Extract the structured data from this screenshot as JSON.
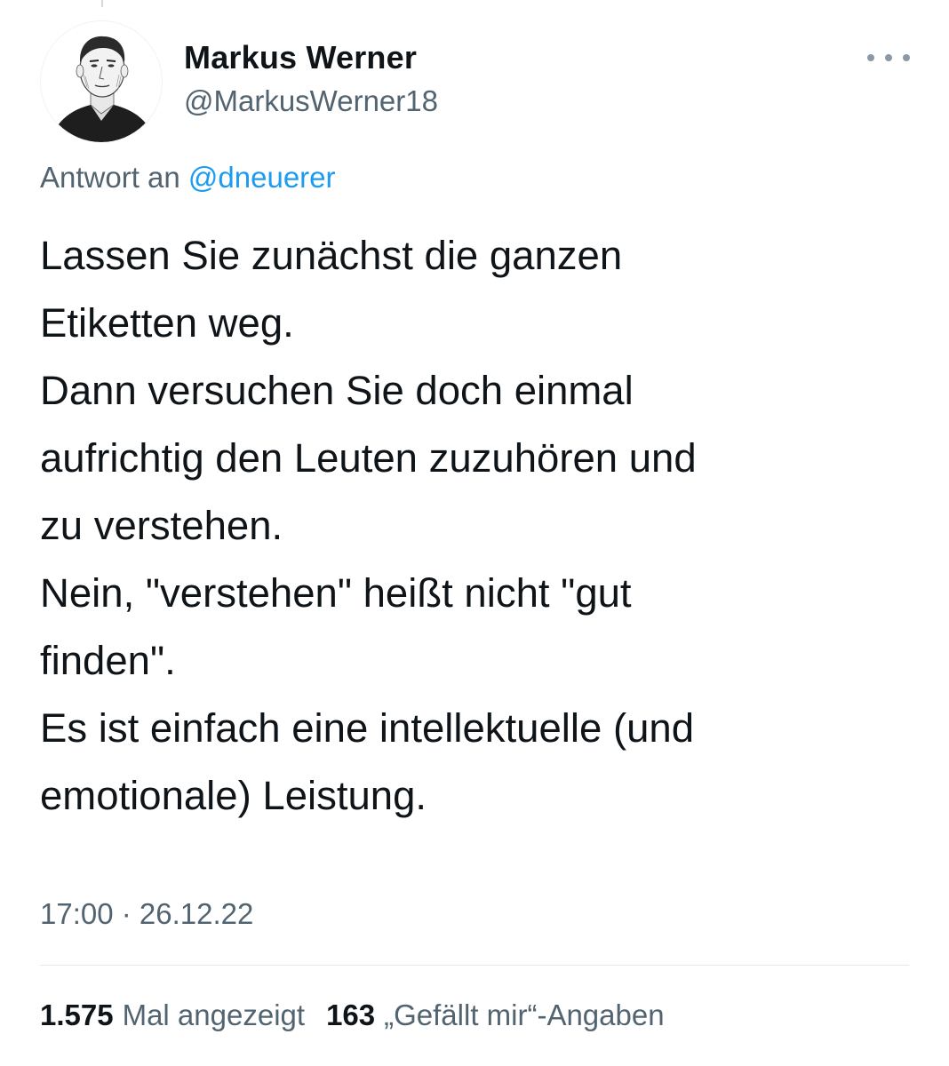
{
  "author": {
    "name": "Markus Werner",
    "handle": "@MarkusWerner18"
  },
  "reply": {
    "prefix": "Antwort an",
    "mention": "@dneuerer"
  },
  "tweet": {
    "lines": [
      "Lassen Sie zunächst die ganzen",
      "Etiketten weg.",
      "Dann versuchen Sie doch einmal",
      "aufrichtig den Leuten zuzuhören und",
      "zu verstehen.",
      "Nein, \"verstehen\" heißt nicht \"gut",
      "finden\".",
      "Es ist einfach eine intellektuelle (und",
      "emotionale) Leistung."
    ],
    "timestamp": "17:00 · 26.12.22"
  },
  "stats": {
    "views_count": "1.575",
    "views_label": "Mal angezeigt",
    "likes_count": "163",
    "likes_label": "„Gefällt mir“-Angaben"
  },
  "icons": {
    "more": "more-horizontal-icon",
    "avatar": "portrait-sketch"
  },
  "colors": {
    "text": "#0f1419",
    "secondary": "#536471",
    "link": "#1d9bf0",
    "divider": "#e1e8ed"
  }
}
